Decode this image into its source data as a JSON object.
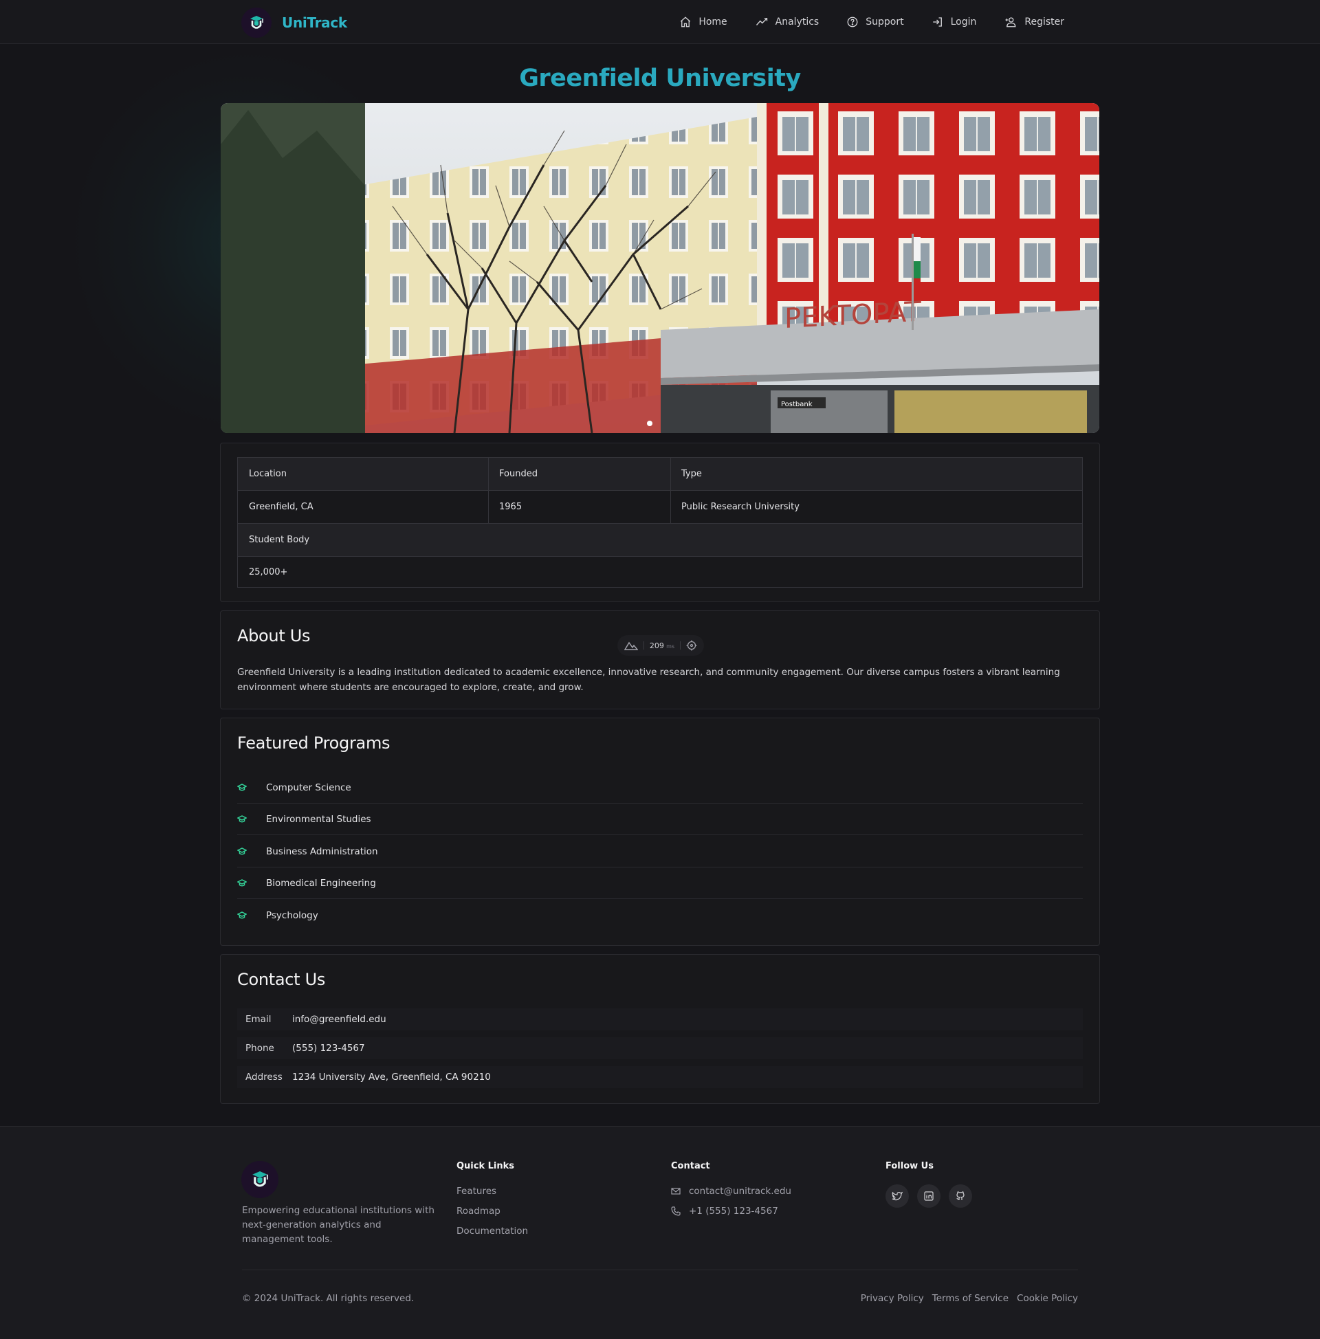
{
  "brand": {
    "name": "UniTrack"
  },
  "nav": {
    "items": [
      {
        "label": "Home",
        "icon": "home-icon"
      },
      {
        "label": "Analytics",
        "icon": "trend-icon"
      },
      {
        "label": "Support",
        "icon": "help-circle-icon"
      },
      {
        "label": "Login",
        "icon": "login-icon"
      },
      {
        "label": "Register",
        "icon": "user-plus-icon"
      }
    ]
  },
  "university": {
    "name": "Greenfield University",
    "photo_sign": "PEKTOPAT",
    "photo_shop_sign": "Postbank"
  },
  "info": {
    "location_label": "Location",
    "location_value": "Greenfield, CA",
    "founded_label": "Founded",
    "founded_value": "1965",
    "type_label": "Type",
    "type_value": "Public Research University",
    "student_body_label": "Student Body",
    "student_body_value": "25,000+"
  },
  "about": {
    "title": "About Us",
    "text": "Greenfield University is a leading institution dedicated to academic excellence, innovative research, and community engagement. Our diverse campus fosters a vibrant learning environment where students are encouraged to explore, create, and grow."
  },
  "perf_pill": {
    "value": "209",
    "unit": "ms"
  },
  "programs": {
    "title": "Featured Programs",
    "items": [
      "Computer Science",
      "Environmental Studies",
      "Business Administration",
      "Biomedical Engineering",
      "Psychology"
    ]
  },
  "contact": {
    "title": "Contact Us",
    "rows": [
      {
        "label": "Email",
        "value": "info@greenfield.edu"
      },
      {
        "label": "Phone",
        "value": "(555) 123-4567"
      },
      {
        "label": "Address",
        "value": "1234 University Ave, Greenfield, CA 90210"
      }
    ]
  },
  "footer": {
    "description": "Empowering educational institutions with next-generation analytics and management tools.",
    "quick_links_title": "Quick Links",
    "quick_links": [
      "Features",
      "Roadmap",
      "Documentation"
    ],
    "contact_title": "Contact",
    "contact_email": "contact@unitrack.edu",
    "contact_phone": "+1 (555) 123-4567",
    "follow_title": "Follow Us",
    "social_icons": [
      "twitter-icon",
      "linkedin-icon",
      "github-icon"
    ],
    "copyright": "© 2024 UniTrack. All rights reserved.",
    "legal": [
      "Privacy Policy",
      "Terms of Service",
      "Cookie Policy"
    ]
  },
  "colors": {
    "accent": "#2aa9bf",
    "program_icon": "#34d399",
    "background": "#151519"
  }
}
